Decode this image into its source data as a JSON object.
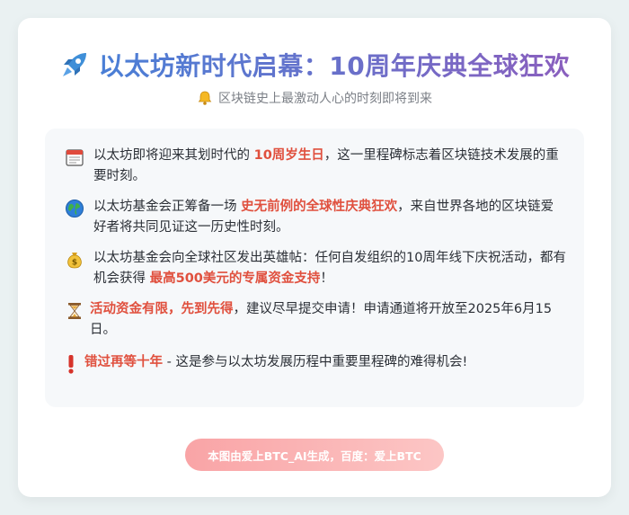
{
  "header": {
    "title": "以太坊新时代启幕：10周年庆典全球狂欢",
    "title_icon": "rocket-icon",
    "subtitle": "区块链史上最激动人心的时刻即将到来",
    "subtitle_icon": "bell-icon",
    "title_gradient": [
      "#4a7fd6",
      "#8a5fbe"
    ]
  },
  "items": [
    {
      "icon": "calendar-icon",
      "before": "以太坊即将迎来其划时代的 ",
      "highlight": "10周岁生日",
      "after": "，这一里程碑标志着区块链技术发展的重要时刻。"
    },
    {
      "icon": "globe-icon",
      "before": "以太坊基金会正筹备一场 ",
      "highlight": "史无前例的全球性庆典狂欢",
      "after": "，来自世界各地的区块链爱好者将共同见证这一历史性时刻。"
    },
    {
      "icon": "money-bag-icon",
      "before": "以太坊基金会向全球社区发出英雄帖：任何自发组织的10周年线下庆祝活动，都有机会获得 ",
      "highlight": "最高500美元的专属资金支持",
      "after": "！"
    },
    {
      "icon": "hourglass-icon",
      "before": "",
      "highlight": "活动资金有限，先到先得",
      "after": "，建议尽早提交申请！申请通道将开放至2025年6月15日。"
    },
    {
      "icon": "exclamation-icon",
      "before": "",
      "highlight": "错过再等十年",
      "after": " - 这是参与以太坊发展历程中重要里程碑的难得机会!"
    }
  ],
  "footer": {
    "label": "本图由爱上BTC_AI生成，百度：爱上BTC"
  },
  "colors": {
    "highlight": "#e0503e",
    "panel_bg": "#f6f8fa",
    "footer_gradient": [
      "#f9a4a6",
      "#fcc6c5"
    ]
  }
}
